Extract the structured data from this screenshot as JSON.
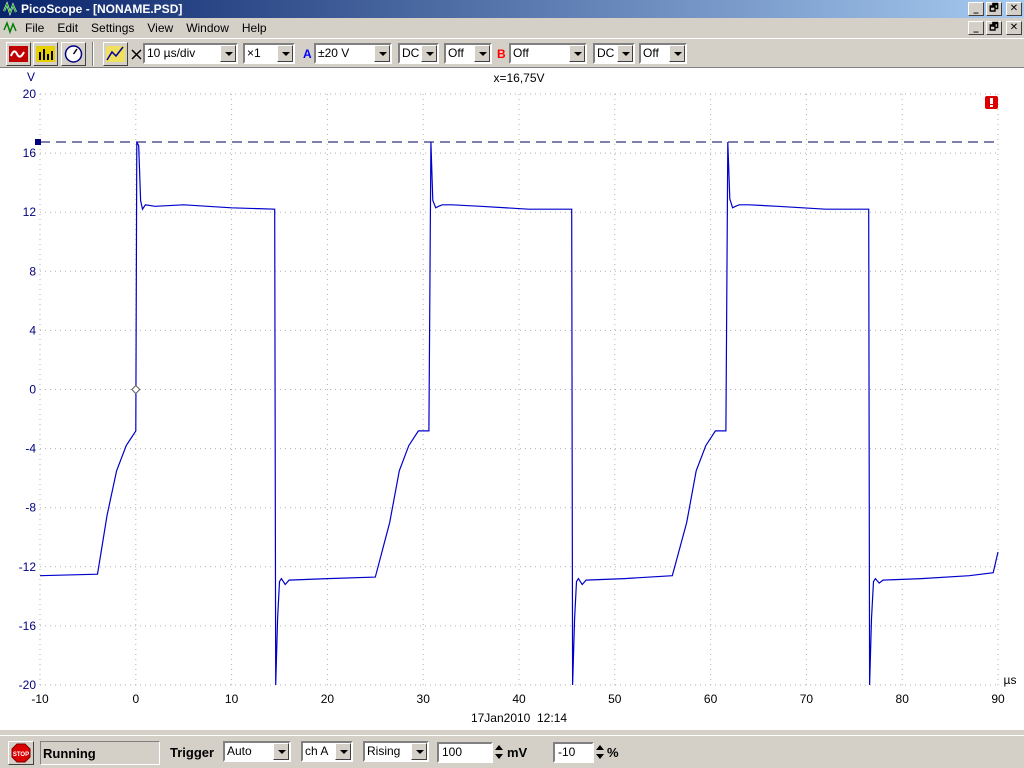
{
  "window": {
    "title": "PicoScope - [NONAME.PSD]",
    "minimize": "_",
    "restore": "🗗",
    "close": "✕"
  },
  "menu": {
    "items": [
      "File",
      "Edit",
      "Settings",
      "View",
      "Window",
      "Help"
    ]
  },
  "toolbar": {
    "timebase": "10 µs/div",
    "magnification": "×1",
    "channel_a_label": "A",
    "channel_a_range": "±20 V",
    "channel_a_coupling": "DC",
    "channel_a_offset": "Off",
    "channel_b_label": "B",
    "channel_b_range": "Off",
    "channel_b_coupling": "DC",
    "channel_b_offset": "Off",
    "icons": [
      "scope-view-icon",
      "spectrum-view-icon",
      "meter-view-icon",
      "new-view-icon",
      "x-axis-icon"
    ]
  },
  "scope": {
    "y_unit": "V",
    "x_unit": "µs",
    "ruler_readout": "x=16,75V",
    "timestamp": "17Jan2010  12:14",
    "trace_color": "#0000cc",
    "axis_label_color": "#000080",
    "warning_icon": "warning-icon"
  },
  "chart_data": {
    "type": "line",
    "title": "",
    "xlabel": "µs",
    "ylabel": "V",
    "xlim": [
      -10,
      90
    ],
    "ylim": [
      -20,
      20
    ],
    "x_ticks": [
      -10,
      0,
      10,
      20,
      30,
      40,
      50,
      60,
      70,
      80,
      90
    ],
    "y_ticks": [
      20,
      16,
      12,
      8,
      4,
      0,
      -4,
      -8,
      -12,
      -16,
      -20
    ],
    "ruler_y": 16.75,
    "trigger_point": [
      0,
      0
    ],
    "series": [
      {
        "x": [
          -10,
          -4,
          -3,
          -2,
          -1,
          0,
          0.1,
          0.3,
          0.5,
          0.7,
          1,
          2,
          5,
          10,
          14.5,
          14.6,
          14.8,
          15,
          15.2,
          15.6,
          16,
          20,
          25,
          26.5,
          27.5,
          28.5,
          29.5,
          30.6,
          30.8,
          31,
          31.3,
          31.6,
          32,
          33,
          36,
          41,
          45.5,
          45.6,
          45.8,
          46,
          46.2,
          46.6,
          47,
          51,
          56,
          57.5,
          58.5,
          59.5,
          60.5,
          61.6,
          61.8,
          62,
          62.3,
          62.6,
          63,
          64,
          67,
          72,
          76.5,
          76.6,
          76.8,
          77,
          77.2,
          77.6,
          78,
          82,
          87,
          89.5,
          90
        ],
        "y": [
          -12.6,
          -12.5,
          -8.5,
          -5.5,
          -3.8,
          -2.8,
          16.75,
          16.5,
          12.8,
          12.2,
          12.5,
          12.4,
          12.5,
          12.3,
          12.2,
          -20,
          -15.5,
          -13,
          -12.8,
          -13.2,
          -12.9,
          -12.8,
          -12.7,
          -9,
          -5.5,
          -3.8,
          -2.8,
          -2.8,
          16.75,
          12.8,
          12.3,
          12.4,
          12.5,
          12.5,
          12.4,
          12.2,
          12.2,
          -20,
          -15.5,
          -13,
          -12.8,
          -13.2,
          -12.9,
          -12.8,
          -12.6,
          -9,
          -5.5,
          -3.8,
          -2.8,
          -2.8,
          16.75,
          12.9,
          12.3,
          12.4,
          12.5,
          12.5,
          12.4,
          12.2,
          12.2,
          -20,
          -15.5,
          -13,
          -12.8,
          -13.1,
          -12.9,
          -12.8,
          -12.6,
          -12.4,
          -11
        ]
      }
    ]
  },
  "status": {
    "state": "Running",
    "trigger_label": "Trigger",
    "trigger_mode": "Auto",
    "trigger_channel": "ch A",
    "trigger_edge": "Rising",
    "threshold": "100",
    "threshold_unit": "mV",
    "delay": "-10",
    "delay_unit": "%",
    "stop_label": "STOP"
  }
}
